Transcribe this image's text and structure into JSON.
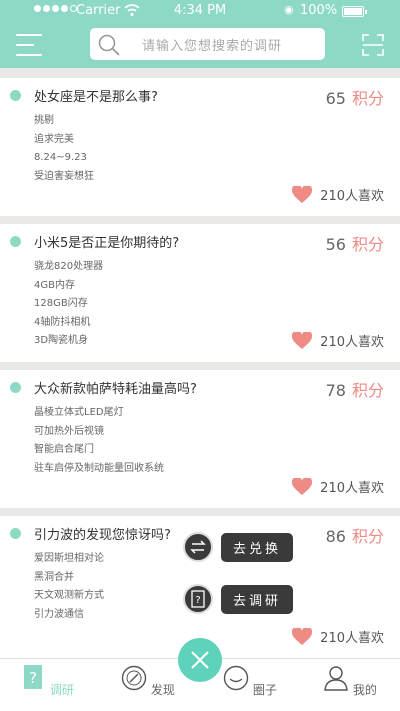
{
  "status": {
    "carrier": "Carrier",
    "time": "4:34 PM",
    "battery": "100%"
  },
  "header": {
    "search_placeholder": "请输入您想搜索的调研"
  },
  "cards": [
    {
      "title": "处女座是不是那么事?",
      "points": "65",
      "unit": "积分",
      "lines": [
        "挑剔",
        "追求完美",
        "8.24~9.23",
        "受迫害妄想狂"
      ],
      "likes": "210人喜欢"
    },
    {
      "title": "小米5是否正是你期待的?",
      "points": "56",
      "unit": "积分",
      "lines": [
        "骁龙820处理器",
        "4GB内存",
        "128GB闪存",
        "4轴防抖相机",
        "3D陶瓷机身"
      ],
      "likes": "210人喜欢"
    },
    {
      "title": "大众新款帕萨特耗油量高吗?",
      "points": "78",
      "unit": "积分",
      "lines": [
        "晶棱立体式LED尾灯",
        "可加热外后视镜",
        "智能启合尾门",
        "驻车启停及制动能量回收系统"
      ],
      "likes": "210人喜欢"
    },
    {
      "title": "引力波的发现您惊讶吗?",
      "points": "86",
      "unit": "积分",
      "lines": [
        "爱因斯坦相对论",
        "黑洞合并",
        "天文观测新方式",
        "引力波通信"
      ],
      "likes": "210人喜欢"
    }
  ],
  "fab": {
    "exchange_label": "去兑换",
    "survey_label": "去调研"
  },
  "tabs": [
    {
      "label": "调研",
      "icon": "survey-icon"
    },
    {
      "label": "发现",
      "icon": "compass-icon"
    },
    {
      "label": "圈子",
      "icon": "circle-face-icon"
    },
    {
      "label": "我的",
      "icon": "person-icon"
    }
  ],
  "colors": {
    "accent": "#8dd9c6",
    "points": "#ee8b84",
    "fab": "#5fd2bc",
    "dark": "#3a3a3a"
  }
}
